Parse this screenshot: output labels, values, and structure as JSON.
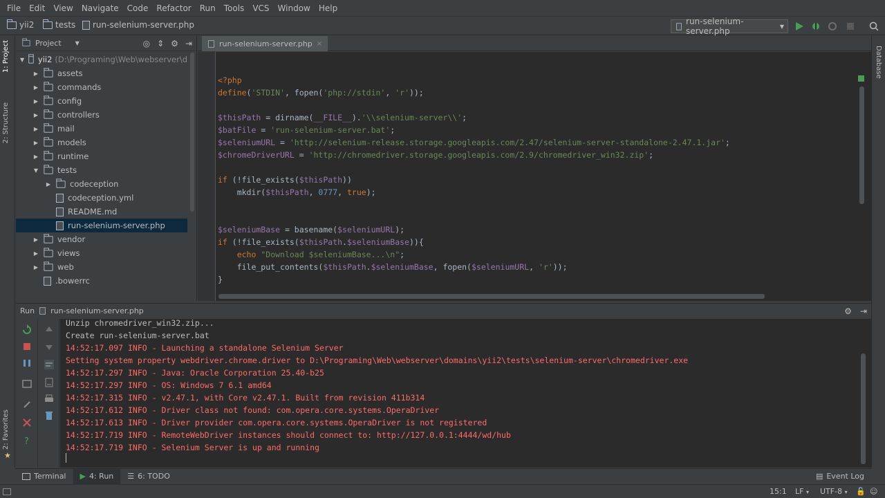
{
  "menu": [
    "File",
    "Edit",
    "View",
    "Navigate",
    "Code",
    "Refactor",
    "Run",
    "Tools",
    "VCS",
    "Window",
    "Help"
  ],
  "breadcrumb": {
    "root": "yii2",
    "folder": "tests",
    "file": "run-selenium-server.php"
  },
  "run_config": {
    "label": "run-selenium-server.php"
  },
  "side_tabs": {
    "project": "1: Project",
    "structure": "2: Structure",
    "favorites": "2: Favorites",
    "database": "Database"
  },
  "project_panel": {
    "title": "Project",
    "root": "yii2",
    "root_path": "(D:\\Programing\\Web\\webserver\\d",
    "items": [
      {
        "label": "assets",
        "type": "folder",
        "depth": 1,
        "expanded": false
      },
      {
        "label": "commands",
        "type": "folder",
        "depth": 1,
        "expanded": false
      },
      {
        "label": "config",
        "type": "folder",
        "depth": 1,
        "expanded": false
      },
      {
        "label": "controllers",
        "type": "folder",
        "depth": 1,
        "expanded": false
      },
      {
        "label": "mail",
        "type": "folder",
        "depth": 1,
        "expanded": false
      },
      {
        "label": "models",
        "type": "folder",
        "depth": 1,
        "expanded": false
      },
      {
        "label": "runtime",
        "type": "folder",
        "depth": 1,
        "expanded": false
      },
      {
        "label": "tests",
        "type": "folder",
        "depth": 1,
        "expanded": true
      },
      {
        "label": "codeception",
        "type": "folder",
        "depth": 2,
        "expanded": false
      },
      {
        "label": "codeception.yml",
        "type": "file",
        "depth": 2
      },
      {
        "label": "README.md",
        "type": "file",
        "depth": 2
      },
      {
        "label": "run-selenium-server.php",
        "type": "file",
        "depth": 2,
        "selected": true
      },
      {
        "label": "vendor",
        "type": "folder",
        "depth": 1,
        "expanded": false
      },
      {
        "label": "views",
        "type": "folder",
        "depth": 1,
        "expanded": false
      },
      {
        "label": "web",
        "type": "folder",
        "depth": 1,
        "expanded": false
      },
      {
        "label": ".bowerrc",
        "type": "file",
        "depth": 1
      }
    ]
  },
  "editor": {
    "tab": "run-selenium-server.php",
    "lines": [
      "<?php",
      "define('STDIN', fopen('php://stdin', 'r'));",
      "",
      "$thisPath = dirname(__FILE__).'\\\\selenium-server\\\\';",
      "$batFile = 'run-selenium-server.bat';",
      "$seleniumURL = 'http://selenium-release.storage.googleapis.com/2.47/selenium-server-standalone-2.47.1.jar';",
      "$chromeDriverURL = 'http://chromedriver.storage.googleapis.com/2.9/chromedriver_win32.zip';",
      "",
      "if (!file_exists($thisPath))",
      "    mkdir($thisPath, 0777, true);",
      "",
      "",
      "$seleniumBase = basename($seleniumURL);",
      "if (!file_exists($thisPath.$seleniumBase)){",
      "    echo \"Download $seleniumBase...\\n\";",
      "    file_put_contents($thisPath.$seleniumBase, fopen($seleniumURL, 'r'));",
      "}"
    ]
  },
  "run_panel": {
    "label": "Run",
    "tab": "run-selenium-server.php",
    "console": [
      {
        "text": "Unzip chromedriver_win32.zip...",
        "kind": "normal"
      },
      {
        "text": "Create run-selenium-server.bat",
        "kind": "normal"
      },
      {
        "text": "14:52:17.097 INFO - Launching a standalone Selenium Server",
        "kind": "error"
      },
      {
        "text": "Setting system property webdriver.chrome.driver to D:\\Programing\\Web\\webserver\\domains\\yii2\\tests\\selenium-server\\chromedriver.exe",
        "kind": "error"
      },
      {
        "text": "14:52:17.297 INFO - Java: Oracle Corporation 25.40-b25",
        "kind": "error"
      },
      {
        "text": "14:52:17.297 INFO - OS: Windows 7 6.1 amd64",
        "kind": "error"
      },
      {
        "text": "14:52:17.315 INFO - v2.47.1, with Core v2.47.1. Built from revision 411b314",
        "kind": "error"
      },
      {
        "text": "14:52:17.612 INFO - Driver class not found: com.opera.core.systems.OperaDriver",
        "kind": "error"
      },
      {
        "text": "14:52:17.613 INFO - Driver provider com.opera.core.systems.OperaDriver is not registered",
        "kind": "error"
      },
      {
        "text": "14:52:17.719 INFO - RemoteWebDriver instances should connect to: http://127.0.0.1:4444/wd/hub",
        "kind": "error"
      },
      {
        "text": "14:52:17.719 INFO - Selenium Server is up and running",
        "kind": "error"
      }
    ]
  },
  "bottom_tabs": {
    "terminal": "Terminal",
    "run": "4: Run",
    "todo": "6: TODO",
    "event_log": "Event Log"
  },
  "status_bar": {
    "position": "15:1",
    "line_sep": "LF",
    "encoding": "UTF-8"
  },
  "colors": {
    "accent_green": "#499c54",
    "console_red": "#ff6b68",
    "selection": "#0d293e"
  }
}
